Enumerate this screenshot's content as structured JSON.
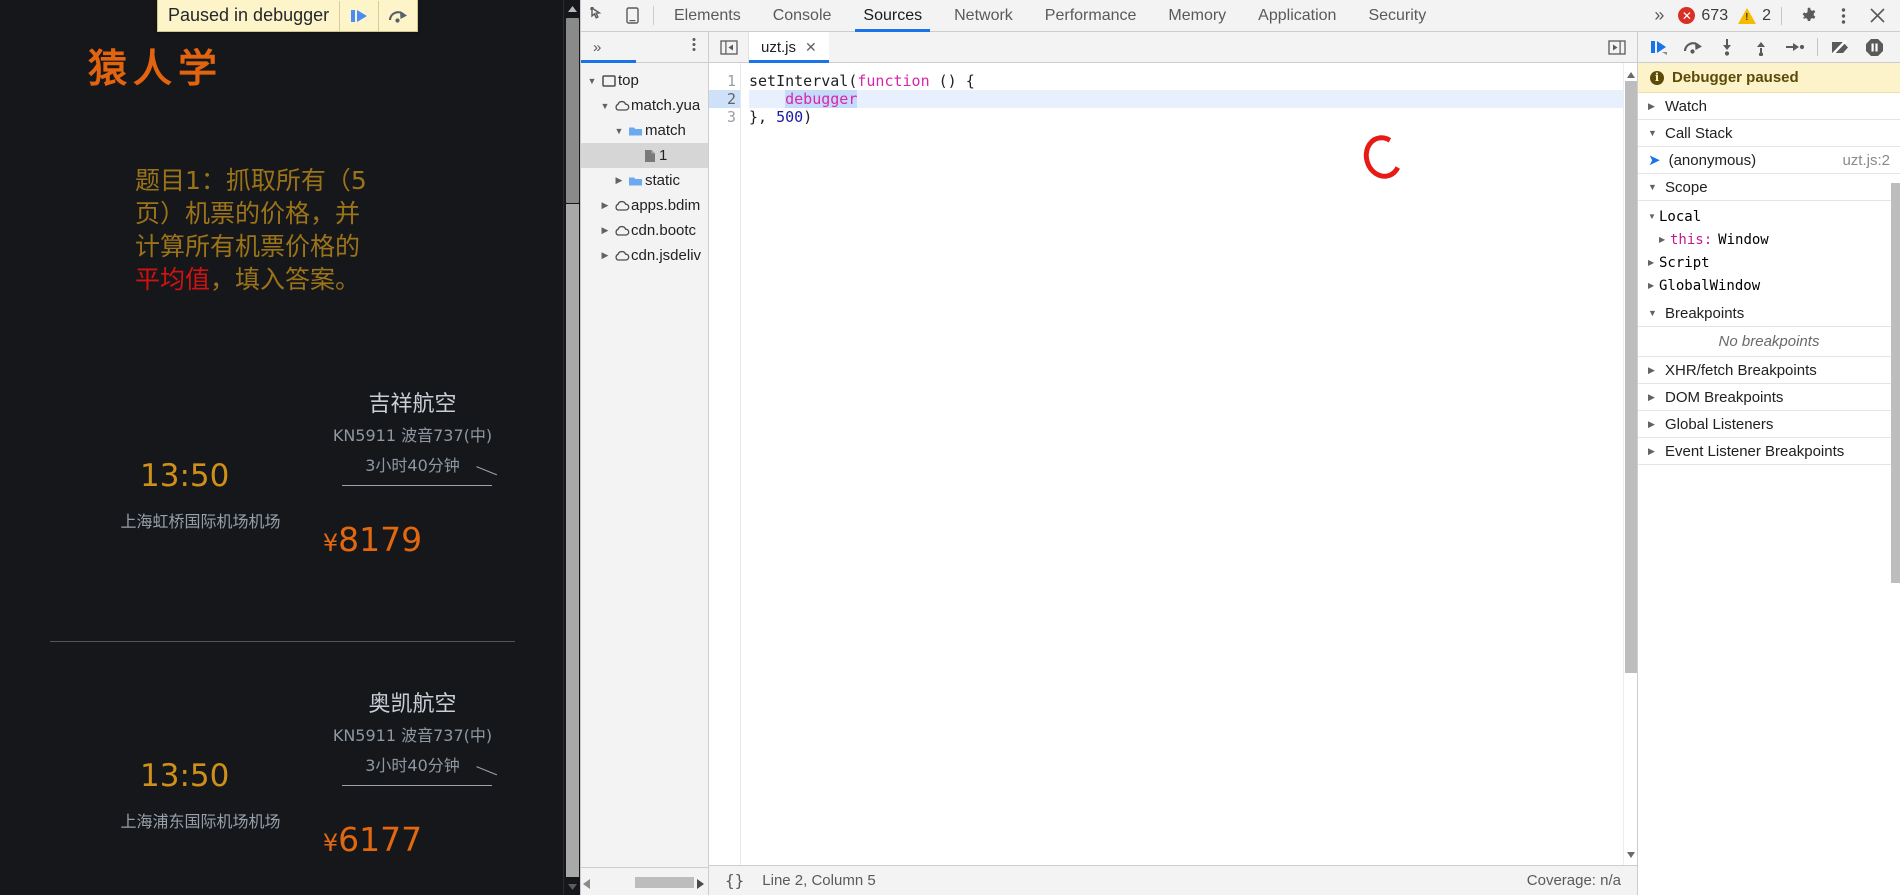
{
  "page": {
    "paused_overlay": {
      "text": "Paused in debugger",
      "resume_icon": "resume-script-icon",
      "step_over_icon": "step-over-icon"
    },
    "brand": "猿人学",
    "task": {
      "line1": "题目1：抓取所有（5",
      "line2": "页）机票的价格，并",
      "line3": "计算所有机票价格的",
      "line4_highlight": "平均值",
      "line4_rest": "，填入答案。",
      "highlight_color": "#cf1212",
      "text_color": "#9b7318"
    },
    "flights": [
      {
        "airline": "吉祥航空",
        "flight_no_plane": "KN5911 波音737(中)",
        "duration": "3小时40分钟",
        "depart_time": "13:50",
        "depart_airport": "上海虹桥国际机场机场",
        "currency": "¥",
        "price": "8179"
      },
      {
        "airline": "奥凯航空",
        "flight_no_plane": "KN5911 波音737(中)",
        "duration": "3小时40分钟",
        "depart_time": "13:50",
        "depart_airport": "上海浦东国际机场机场",
        "currency": "¥",
        "price": "6177"
      }
    ]
  },
  "devtools": {
    "toolbar": {
      "inspect_icon": "inspect-element-icon",
      "device_icon": "device-toolbar-icon",
      "more_tabs": "»",
      "errors": "673",
      "warnings": "2",
      "settings_icon": "gear-icon",
      "more_icon": "kebab-menu-icon",
      "close_icon": "close-icon"
    },
    "tabs": [
      {
        "label": "Elements",
        "active": false
      },
      {
        "label": "Console",
        "active": false
      },
      {
        "label": "Sources",
        "active": true
      },
      {
        "label": "Network",
        "active": false
      },
      {
        "label": "Performance",
        "active": false
      },
      {
        "label": "Memory",
        "active": false
      },
      {
        "label": "Application",
        "active": false
      },
      {
        "label": "Security",
        "active": false
      }
    ],
    "navigator": {
      "expand_icon": "»",
      "more_icon": "kebab-menu-icon",
      "tree": [
        {
          "label": "top",
          "icon": "frame-icon",
          "twisty": "▼",
          "indent": 0,
          "selected": false
        },
        {
          "label": "match.yua",
          "icon": "cloud-icon",
          "twisty": "▼",
          "indent": 1,
          "selected": false
        },
        {
          "label": "match",
          "icon": "folder-icon",
          "twisty": "▼",
          "indent": 2,
          "selected": false
        },
        {
          "label": "1",
          "icon": "file-icon",
          "twisty": "",
          "indent": 3,
          "selected": true
        },
        {
          "label": "static",
          "icon": "folder-icon",
          "twisty": "▶",
          "indent": 2,
          "selected": false
        },
        {
          "label": "apps.bdim",
          "icon": "cloud-icon",
          "twisty": "▶",
          "indent": 1,
          "selected": false
        },
        {
          "label": "cdn.bootc",
          "icon": "cloud-icon",
          "twisty": "▶",
          "indent": 1,
          "selected": false
        },
        {
          "label": "cdn.jsdeliv",
          "icon": "cloud-icon",
          "twisty": "▶",
          "indent": 1,
          "selected": false
        }
      ]
    },
    "editor": {
      "panel_toggle_icon": "show-navigator-icon",
      "tab_name": "uzt.js",
      "tab_close_icon": "close-icon",
      "right_toggle_icon": "show-debugger-icon",
      "gutter": [
        "1",
        "2",
        "3"
      ],
      "current_line": 2,
      "code": {
        "line1_a": "setInterval(",
        "line1_kw": "function",
        "line1_b": " () {",
        "line2_indent": "    ",
        "line2_token": "debugger",
        "line3_a": "}, ",
        "line3_num": "500",
        "line3_b": ")"
      },
      "annotation": "red-circle-highlight",
      "status": {
        "format_icon": "{}",
        "position": "Line 2, Column 5",
        "coverage": "Coverage: n/a"
      }
    },
    "debugger": {
      "controls": [
        "resume-script-icon",
        "step-over-icon",
        "step-into-icon",
        "step-out-icon",
        "step-icon",
        "deactivate-breakpoints-icon",
        "pause-on-exceptions-icon"
      ],
      "paused_banner": "Debugger paused",
      "sections": [
        {
          "name": "Watch",
          "twisty": "▶"
        },
        {
          "name": "Call Stack",
          "twisty": "▼"
        }
      ],
      "call_stack": [
        {
          "frame": "(anonymous)",
          "location": "uzt.js:2",
          "marker": "current-frame-icon"
        }
      ],
      "scope_label": "Scope",
      "scope": [
        {
          "name": "Local",
          "twisty": "▼",
          "level": 0,
          "value": ""
        },
        {
          "name": "this:",
          "twisty": "▶",
          "level": 1,
          "value": "Window",
          "keyword": true
        },
        {
          "name": "Script",
          "twisty": "▶",
          "level": 0,
          "value": ""
        },
        {
          "name": "Global",
          "twisty": "▶",
          "level": 0,
          "value": "Window"
        }
      ],
      "breakpoints_label": "Breakpoints",
      "no_breakpoints": "No breakpoints",
      "more_sections": [
        "XHR/fetch Breakpoints",
        "DOM Breakpoints",
        "Global Listeners",
        "Event Listener Breakpoints"
      ]
    }
  }
}
